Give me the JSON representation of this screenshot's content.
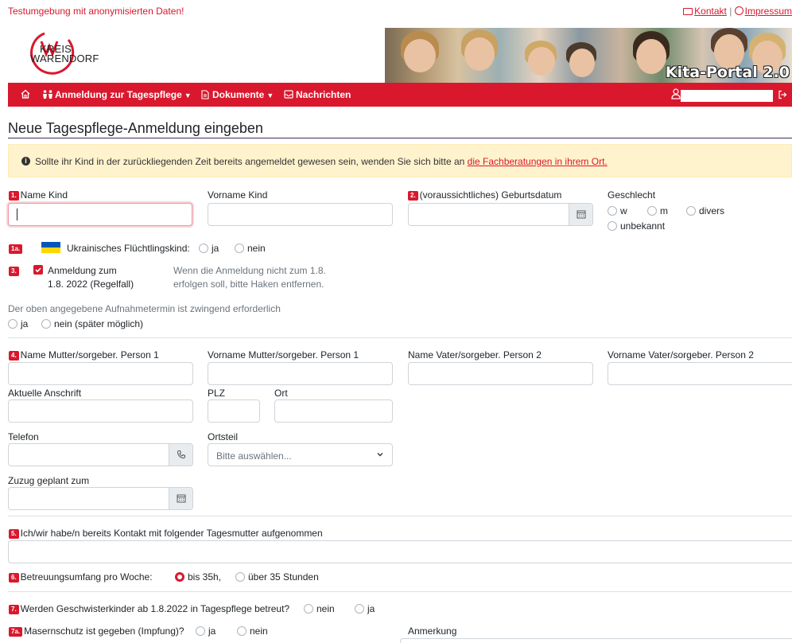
{
  "top": {
    "env_warning": "Testumgebung mit anonymisierten Daten!",
    "kontakt": "Kontakt",
    "separator": "|",
    "impressum": "Impressum"
  },
  "logo": {
    "line1": "KREIS",
    "line2": "WARENDORF"
  },
  "banner": {
    "title": "Kita-Portal 2.0"
  },
  "nav": {
    "item1": "Anmeldung zur Tagespflege",
    "item2": "Dokumente",
    "item3": "Nachrichten"
  },
  "page_title": "Neue Tagespflege-Anmeldung eingeben",
  "alert": {
    "text": "Sollte ihr Kind in der zurückliegenden Zeit bereits angemeldet gewesen sein, wenden Sie sich bitte an",
    "link": "die Fachberatungen in ihrem Ort."
  },
  "badges": {
    "b1": "1.",
    "b2": "2.",
    "b1a": "1a.",
    "b3": "3.",
    "b4": "4.",
    "b5": "5.",
    "b6": "6.",
    "b7": "7.",
    "b7a": "7a."
  },
  "child": {
    "name_label": "Name Kind",
    "vorname_label": "Vorname Kind",
    "geburtsdatum_label": "(voraussichtliches) Geburtsdatum",
    "geschlecht_label": "Geschlecht",
    "gender_options": {
      "w": "w",
      "m": "m",
      "divers": "divers",
      "unbekannt": "unbekannt"
    }
  },
  "ukraine": {
    "label": "Ukrainisches Flüchtlingskind:",
    "ja": "ja",
    "nein": "nein"
  },
  "registration": {
    "label_line1": "Anmeldung zum",
    "label_line2": "1.8. 2022 (Regelfall)",
    "hint_line1": "Wenn die Anmeldung nicht zum 1.8.",
    "hint_line2": "erfolgen soll, bitte Haken entfernen."
  },
  "aufnahme": {
    "label": "Der oben angegebene Aufnahmetermin ist zwingend erforderlich",
    "ja": "ja",
    "nein": "nein (später möglich)"
  },
  "parents": {
    "name_mutter": "Name Mutter/sorgeber. Person 1",
    "vorname_mutter": "Vorname Mutter/sorgeber. Person 1",
    "name_vater": "Name Vater/sorgeber. Person 2",
    "vorname_vater": "Vorname Vater/sorgeber. Person 2",
    "anschrift": "Aktuelle Anschrift",
    "plz": "PLZ",
    "ort": "Ort",
    "telefon": "Telefon",
    "ortsteil": "Ortsteil",
    "ortsteil_value": "Bitte auswählen...",
    "zuzug": "Zuzug geplant zum"
  },
  "tagesmutter": {
    "label": "Ich/wir habe/n bereits Kontakt mit folgender Tagesmutter aufgenommen"
  },
  "betreuung": {
    "label": "Betreuungsumfang pro Woche:",
    "opt1": "bis 35h,",
    "opt2": "über 35 Stunden"
  },
  "geschwister": {
    "label": "Werden Geschwisterkinder ab 1.8.2022 in Tagespflege betreut?",
    "nein": "nein",
    "ja": "ja"
  },
  "masern": {
    "label": "Masernschutz ist gegeben (Impfung)?",
    "ja": "ja",
    "nein": "nein",
    "anmerkung": "Anmerkung"
  },
  "colors": {
    "brand_red": "#d9182d",
    "alert_bg": "#fff3cd"
  }
}
